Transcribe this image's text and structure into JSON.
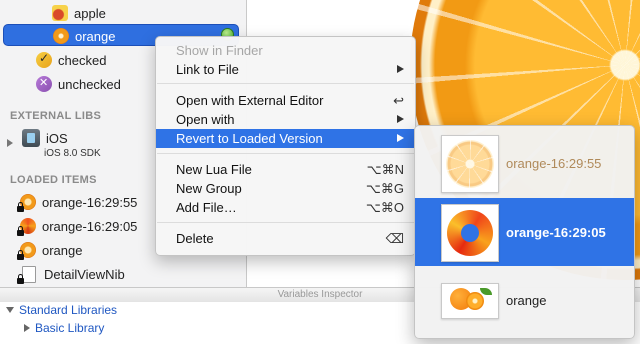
{
  "sidebar": {
    "items_top": [
      {
        "label": "apple",
        "icon": "apple-icon"
      },
      {
        "label": "orange",
        "icon": "orange-icon"
      },
      {
        "label": "checked",
        "icon": "checked-icon"
      },
      {
        "label": "unchecked",
        "icon": "unchecked-icon"
      }
    ],
    "external_libs_header": "EXTERNAL LIBS",
    "ios_label": "iOS",
    "ios_sdk": "iOS 8.0 SDK",
    "loaded_items_header": "LOADED ITEMS",
    "loaded_items": [
      {
        "label": "orange-16:29:55"
      },
      {
        "label": "orange-16:29:05"
      },
      {
        "label": "orange"
      },
      {
        "label": "DetailViewNib"
      }
    ]
  },
  "variables_inspector": {
    "title": "Variables Inspector",
    "standard_libraries": "Standard Libraries",
    "basic_library": "Basic Library"
  },
  "context_menu": {
    "items": [
      {
        "label": "Show in Finder",
        "disabled": true
      },
      {
        "label": "Link to File",
        "submenu": true
      },
      {
        "label": "Open with External Editor",
        "shortcut": "↩"
      },
      {
        "label": "Open with",
        "submenu": true
      },
      {
        "label": "Revert to Loaded Version",
        "submenu": true,
        "highlighted": true
      },
      {
        "label": "New Lua File",
        "shortcut": "⌥⌘N"
      },
      {
        "label": "New Group",
        "shortcut": "⌥⌘G"
      },
      {
        "label": "Add File…",
        "shortcut": "⌥⌘O"
      },
      {
        "label": "Delete",
        "shortcut": "⌫"
      }
    ]
  },
  "revert_submenu": {
    "items": [
      {
        "label": "orange-16:29:55"
      },
      {
        "label": "orange-16:29:05",
        "highlighted": true
      },
      {
        "label": "orange"
      }
    ]
  },
  "colors": {
    "selection": "#2f73e6",
    "menu_background": "#f6f6f6",
    "link_blue": "#2058c2"
  }
}
